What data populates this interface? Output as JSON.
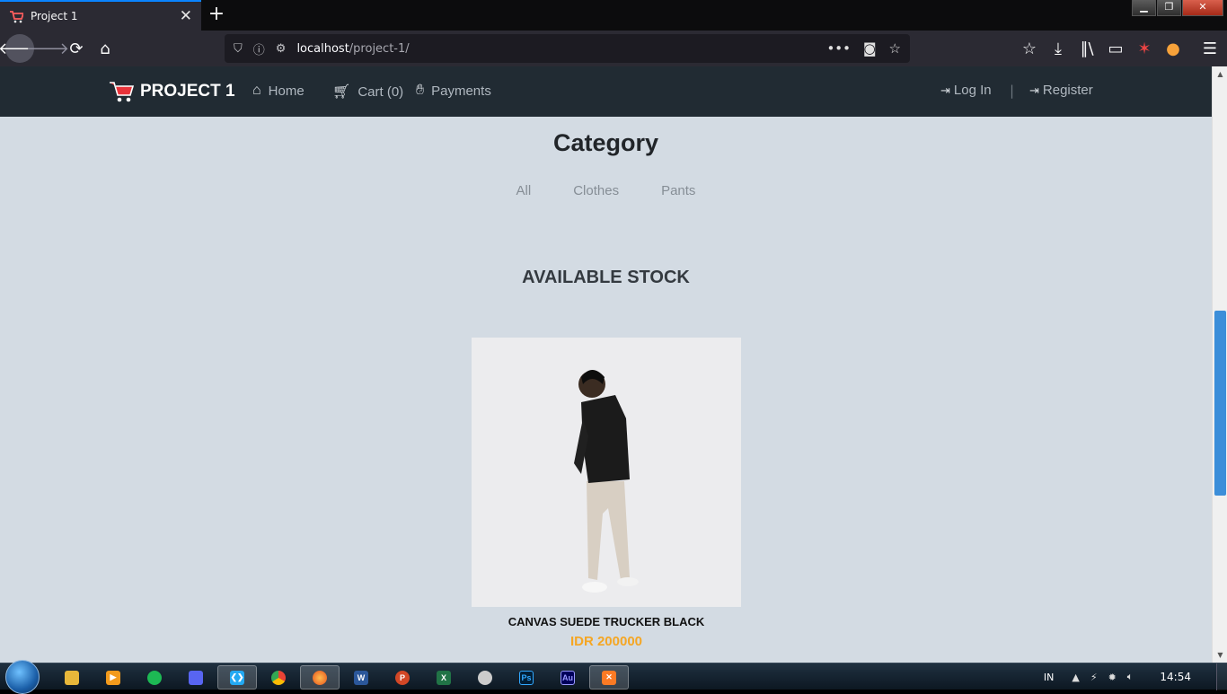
{
  "browser": {
    "tab_title": "Project 1",
    "new_tab_label": "+",
    "url_host": "localhost",
    "url_path": "/project-1/"
  },
  "site": {
    "brand": "PROJECT 1",
    "nav": {
      "home": "Home",
      "cart": "Cart (0)",
      "payments": "Payments",
      "login": "Log In",
      "separator": "|",
      "register": "Register"
    }
  },
  "category": {
    "title": "Category",
    "items": [
      "All",
      "Clothes",
      "Pants"
    ]
  },
  "stock": {
    "title": "AVAILABLE STOCK",
    "products": [
      {
        "name": "CANVAS SUEDE TRUCKER BLACK",
        "price": "IDR 200000"
      }
    ]
  },
  "taskbar": {
    "language": "IN",
    "clock": "14:54"
  },
  "colors": {
    "accent": "#f5a623",
    "site_nav_bg": "#212b33",
    "page_bg": "#d3dbe3"
  }
}
